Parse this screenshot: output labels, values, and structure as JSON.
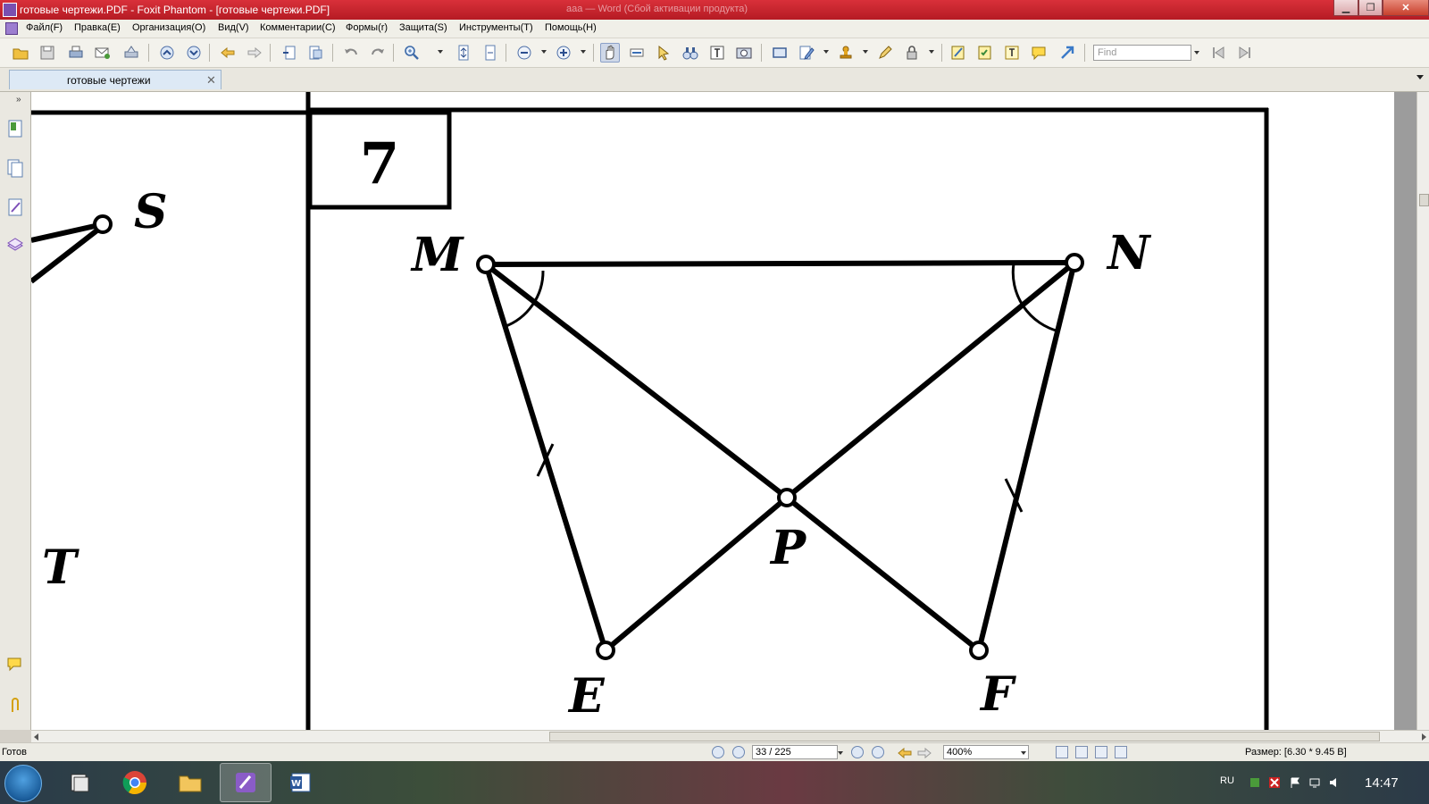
{
  "window": {
    "title": "готовые чертежи.PDF - Foxit Phantom - [готовые чертежи.PDF]",
    "ghost_title": "ааа — Word (Сбой активации продукта)"
  },
  "menu": {
    "items": [
      "Файл(F)",
      "Правка(E)",
      "Организация(O)",
      "Вид(V)",
      "Комментарии(C)",
      "Формы(r)",
      "Защита(S)",
      "Инструменты(T)",
      "Помощь(H)"
    ]
  },
  "toolbar": {
    "find_placeholder": "Find",
    "icons": [
      "open-icon",
      "save-icon",
      "print-icon",
      "email-icon",
      "scan-icon",
      "page-up-icon",
      "page-down-icon",
      "back-icon",
      "forward-icon",
      "insert-page-icon",
      "extract-page-icon",
      "undo-icon",
      "redo-icon",
      "zoom-in-icon",
      "fit-page-icon",
      "fit-width-icon",
      "zoom-minus-icon",
      "zoom-plus-icon",
      "hand-tool-icon",
      "select-text-icon",
      "select-arrow-icon",
      "find-binoculars-icon",
      "typewriter-icon",
      "snapshot-icon",
      "rectangle-icon",
      "edit-icon",
      "stamp-icon",
      "pencil-icon",
      "lock-icon",
      "note-icon",
      "checklist-icon",
      "textbox-icon",
      "comment-icon",
      "arrow-icon",
      "prev-find-icon",
      "next-find-icon"
    ]
  },
  "tab": {
    "label": "готовые чертежи"
  },
  "document": {
    "box_number": "7",
    "points": {
      "M": "M",
      "N": "N",
      "P": "P",
      "E": "E",
      "F": "F",
      "S": "S",
      "T": "T"
    }
  },
  "status": {
    "ready": "Готов",
    "page": "33 / 225",
    "zoom": "400%",
    "size": "Размер: [6.30 * 9.45 В]"
  },
  "taskbar": {
    "lang": "RU",
    "time": "14:47"
  },
  "colors": {
    "title_red": "#c8232c",
    "accent_blue": "#3a6fb5"
  }
}
